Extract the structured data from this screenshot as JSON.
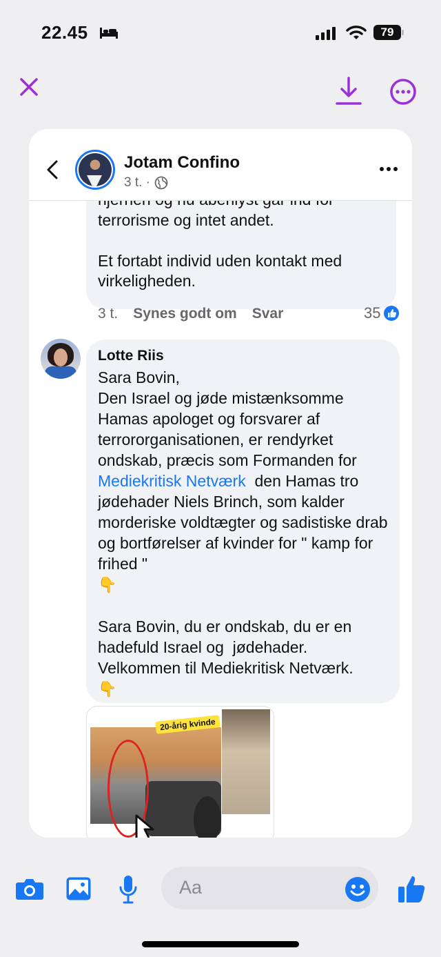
{
  "status_bar": {
    "time": "22.45",
    "battery": "79"
  },
  "post": {
    "author": "Jotam Confino",
    "meta": "3 t. ·"
  },
  "comments": [
    {
      "text": "hjernen og nu åbenlyst går ind for\nterrorisme og intet andet.\n\nEt fortabt individ uden kontakt med\nvirkeligheden.",
      "time": "3 t.",
      "like_label": "Synes godt om",
      "reply_label": "Svar",
      "likes": "35"
    },
    {
      "author": "Lotte Riis",
      "text_before_link": "Sara Bovin,\nDen Israel og jøde mistænksomme Hamas apologet og forsvarer af terrororganisationen, er rendyrket ondskab, præcis som Formanden for ",
      "link": "Mediekritisk Netværk",
      "text_after_link": "  den Hamas tro jødehader Niels Brinch, som kalder morderiske voldtægter og sadistiske drab og bortførelser af kvinder for \" kamp for frihed \"",
      "text_para2": "Sara Bovin, du er ondskab, du er en hadefuld Israel og  jødehader.\nVelkommen til Mediekritisk Netværk.",
      "hand_emoji": "👇",
      "image_caption": "20-årig kvinde"
    }
  ],
  "composer": {
    "placeholder": "Aa"
  },
  "colors": {
    "accent_purple": "#9b30d9",
    "facebook_blue": "#1877f2"
  }
}
